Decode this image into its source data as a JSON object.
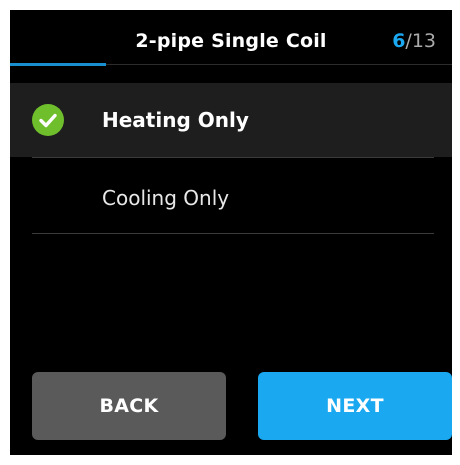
{
  "header": {
    "title": "2-pipe Single Coil",
    "step_current": "6",
    "step_total": "/13"
  },
  "progress": {
    "current_step": 6,
    "total_steps": 13
  },
  "options": [
    {
      "label": "Heating Only",
      "selected": true
    },
    {
      "label": "Cooling Only",
      "selected": false
    }
  ],
  "buttons": {
    "back_label": "BACK",
    "next_label": "NEXT"
  },
  "colors": {
    "accent": "#1aa8f0",
    "check": "#6fbe2c",
    "back_button": "#5a5a5a",
    "background": "#000000"
  },
  "icons": {
    "selected_option": "checkmark-circle-icon"
  }
}
